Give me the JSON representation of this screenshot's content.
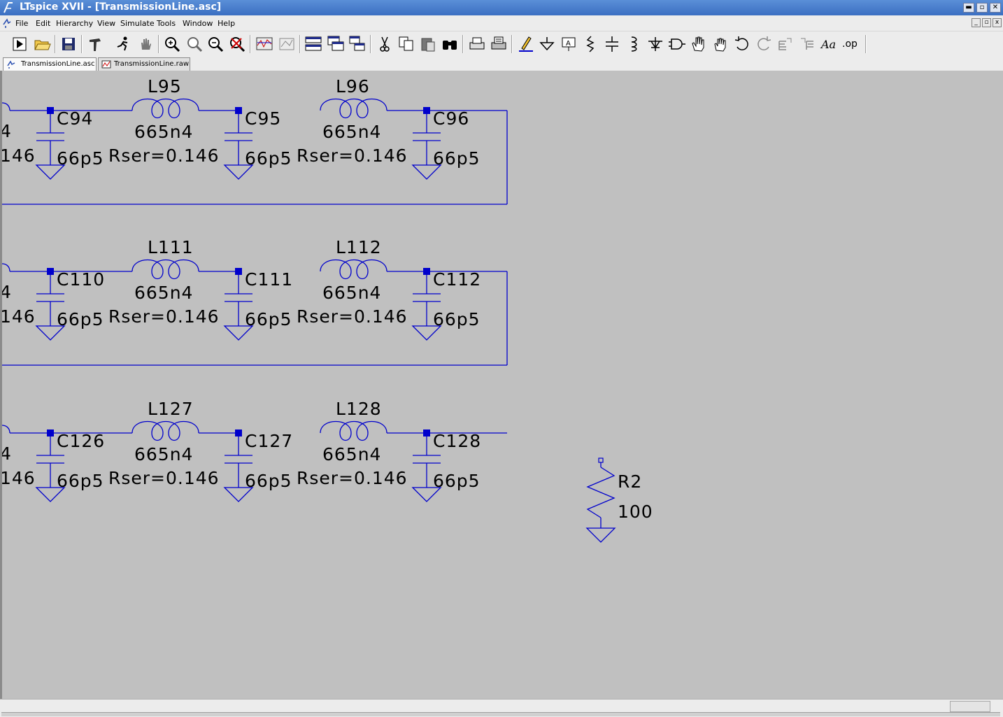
{
  "window": {
    "title": "LTspice XVII - [TransmissionLine.asc]"
  },
  "window_controls": [
    "minimize",
    "maximize",
    "close"
  ],
  "menu": [
    {
      "label": "File"
    },
    {
      "label": "Edit"
    },
    {
      "label": "Hierarchy"
    },
    {
      "label": "View"
    },
    {
      "label": "Simulate"
    },
    {
      "label": "Tools"
    },
    {
      "label": "Window"
    },
    {
      "label": "Help"
    }
  ],
  "toolbar": [
    "run-icon",
    "open-icon",
    "save-icon",
    "hammer-icon",
    "run-man-icon",
    "halt-hand-icon",
    "zoom-in-icon",
    "zoom-full-icon",
    "zoom-out-icon",
    "zoom-cancel-icon",
    "waveform-icon",
    "autorange-icon",
    "tile-horizontal-icon",
    "cascade-icon",
    "tile-vertical-icon",
    "cut-icon",
    "copy-icon",
    "paste-icon",
    "find-icon",
    "print-preview-icon",
    "print-icon",
    "wire-pencil-icon",
    "ground-icon",
    "label-net-icon",
    "resistor-icon",
    "capacitor-icon",
    "inductor-icon",
    "diode-icon",
    "component-icon",
    "move-hand-icon",
    "drag-hand-icon",
    "undo-icon",
    "redo-icon",
    "rotate-icon",
    "mirror-icon",
    "text-icon",
    "spice-directive-icon"
  ],
  "toolbar_text": {
    "text_tool": "Aa",
    "spice_directive": ".op"
  },
  "tabs": [
    {
      "label": "TransmissionLine.asc",
      "active": true
    },
    {
      "label": "TransmissionLine.raw",
      "active": false
    }
  ],
  "schematic": {
    "rows": [
      {
        "left_partial": {
          "value": "4",
          "rser": "146"
        },
        "inductors": [
          {
            "name": "L95",
            "value": "665n4",
            "rser": "Rser=0.146"
          },
          {
            "name": "L96",
            "value": "665n4",
            "rser": "Rser=0.146"
          }
        ],
        "capacitors": [
          {
            "name": "C94",
            "value": "66p5"
          },
          {
            "name": "C95",
            "value": "66p5"
          },
          {
            "name": "C96",
            "value": "66p5"
          }
        ]
      },
      {
        "left_partial": {
          "value": "4",
          "rser": "146"
        },
        "inductors": [
          {
            "name": "L111",
            "value": "665n4",
            "rser": "Rser=0.146"
          },
          {
            "name": "L112",
            "value": "665n4",
            "rser": "Rser=0.146"
          }
        ],
        "capacitors": [
          {
            "name": "C110",
            "value": "66p5"
          },
          {
            "name": "C111",
            "value": "66p5"
          },
          {
            "name": "C112",
            "value": "66p5"
          }
        ]
      },
      {
        "left_partial": {
          "value": "4",
          "rser": "146"
        },
        "inductors": [
          {
            "name": "L127",
            "value": "665n4",
            "rser": "Rser=0.146"
          },
          {
            "name": "L128",
            "value": "665n4",
            "rser": "Rser=0.146"
          }
        ],
        "capacitors": [
          {
            "name": "C126",
            "value": "66p5"
          },
          {
            "name": "C127",
            "value": "66p5"
          },
          {
            "name": "C128",
            "value": "66p5"
          }
        ]
      }
    ],
    "resistor": {
      "name": "R2",
      "value": "100"
    },
    "wire_color": "#0000cc",
    "background_color": "#c0c0c0"
  }
}
